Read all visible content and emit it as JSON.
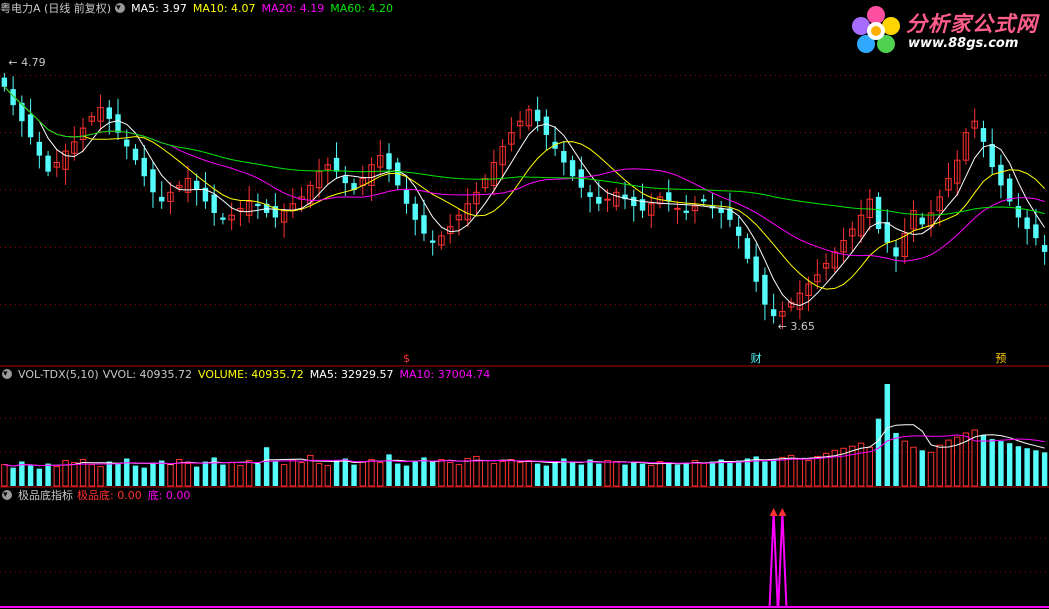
{
  "main_header": {
    "title": "粤电力A (日线 前复权)",
    "ma5": "MA5: 3.97",
    "ma10": "MA10: 4.07",
    "ma20": "MA20: 4.19",
    "ma60": "MA60: 4.20"
  },
  "vol_header": {
    "name": "VOL-TDX(5,10)",
    "vvol": "VVOL: 40935.72",
    "volume": "VOLUME: 40935.72",
    "ma5": "MA5: 32929.57",
    "ma10": "MA10: 37004.74"
  },
  "ind_header": {
    "name": "极品底指标",
    "jpd": "极品底: 0.00",
    "di": "底: 0.00"
  },
  "logo": {
    "title": "分析家公式网",
    "url": "www.88gs.com"
  },
  "colors": {
    "up": "#ff3232",
    "down": "#54fcfc",
    "ma5": "#ffffff",
    "ma10": "#ffff00",
    "ma20": "#ff00ff",
    "ma60": "#00e600",
    "grid": "#a00000",
    "indicator": "#ff00ff"
  },
  "chart_data": {
    "type": "candlestick",
    "title": "粤电力A (日线 前复权)",
    "price_range": [
      3.5,
      5.0
    ],
    "high_label": "4.79",
    "low_label": "3.65",
    "markers": [
      "$",
      "财",
      "预"
    ],
    "closes": [
      4.7,
      4.62,
      4.55,
      4.48,
      4.4,
      4.33,
      4.37,
      4.42,
      4.46,
      4.52,
      4.57,
      4.61,
      4.56,
      4.5,
      4.44,
      4.38,
      4.31,
      4.24,
      4.2,
      4.24,
      4.27,
      4.3,
      4.25,
      4.2,
      4.15,
      4.12,
      4.14,
      4.17,
      4.2,
      4.18,
      4.15,
      4.13,
      4.16,
      4.19,
      4.22,
      4.27,
      4.33,
      4.36,
      4.33,
      4.28,
      4.25,
      4.3,
      4.36,
      4.4,
      4.34,
      4.27,
      4.19,
      4.12,
      4.06,
      4.02,
      4.05,
      4.09,
      4.14,
      4.19,
      4.24,
      4.3,
      4.37,
      4.44,
      4.5,
      4.55,
      4.6,
      4.55,
      4.49,
      4.43,
      4.37,
      4.31,
      4.26,
      4.22,
      4.19,
      4.21,
      4.24,
      4.21,
      4.18,
      4.16,
      4.19,
      4.22,
      4.2,
      4.17,
      4.15,
      4.18,
      4.2,
      4.17,
      4.15,
      4.12,
      4.05,
      3.95,
      3.85,
      3.75,
      3.7,
      3.72,
      3.76,
      3.8,
      3.84,
      3.88,
      3.93,
      3.98,
      4.03,
      4.08,
      4.14,
      4.21,
      4.08,
      4.02,
      3.96,
      4.06,
      4.16,
      4.1,
      4.15,
      4.22,
      4.3,
      4.38,
      4.5,
      4.55,
      4.46,
      4.35,
      4.27,
      4.2,
      4.13,
      4.08,
      4.04,
      3.98
    ],
    "volume": {
      "name": "VOL-TDX(5,10)",
      "vvol": 40935.72,
      "ma5": 32929.57,
      "ma10": 37004.74,
      "values": [
        21,
        18,
        24,
        20,
        17,
        22,
        19,
        25,
        23,
        26,
        21,
        19,
        24,
        22,
        27,
        20,
        18,
        23,
        25,
        21,
        26,
        22,
        19,
        24,
        28,
        21,
        23,
        20,
        25,
        22,
        38,
        24,
        21,
        26,
        23,
        30,
        22,
        20,
        25,
        27,
        21,
        24,
        26,
        23,
        31,
        22,
        20,
        25,
        28,
        24,
        26,
        23,
        21,
        27,
        29,
        25,
        22,
        24,
        26,
        23,
        25,
        22,
        20,
        24,
        27,
        23,
        21,
        26,
        22,
        25,
        24,
        21,
        23,
        22,
        20,
        24,
        22,
        21,
        23,
        25,
        22,
        24,
        26,
        23,
        25,
        27,
        29,
        24,
        26,
        28,
        30,
        27,
        25,
        29,
        32,
        35,
        37,
        39,
        42,
        38,
        66,
        100,
        52,
        44,
        38,
        35,
        33,
        40,
        45,
        48,
        52,
        55,
        50,
        46,
        44,
        42,
        39,
        37,
        35,
        33
      ]
    },
    "indicator": {
      "name": "极品底指标",
      "jpd": 0.0,
      "di": 0.0,
      "spikes": [
        88,
        89
      ]
    }
  }
}
